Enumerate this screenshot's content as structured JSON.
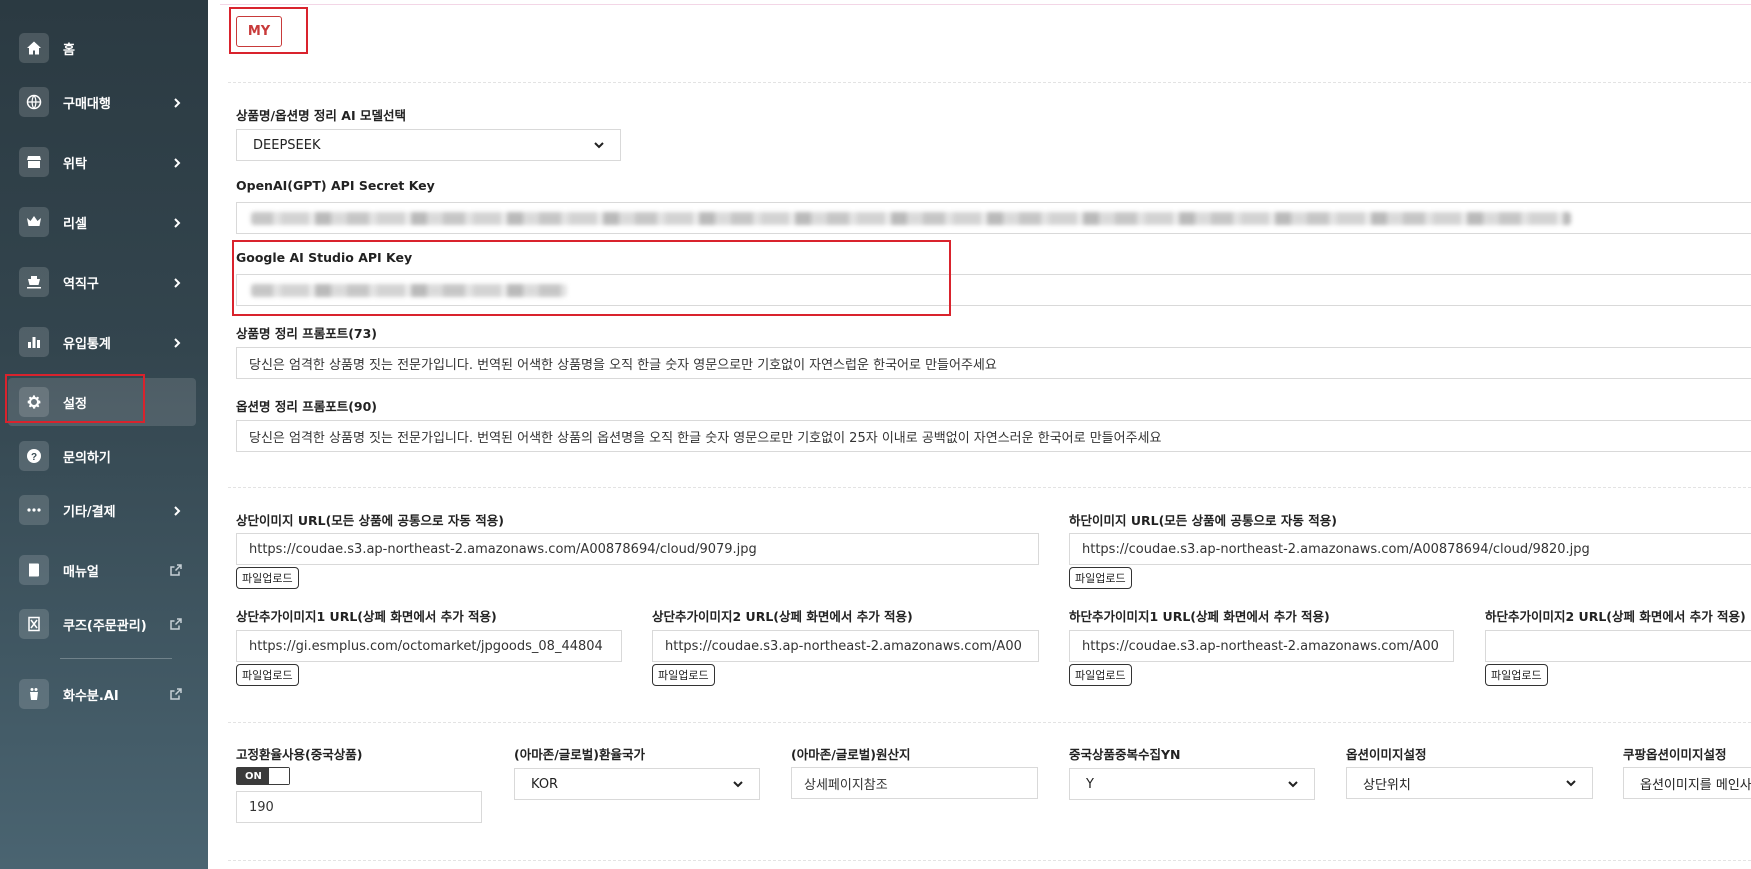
{
  "sidebar": {
    "items": [
      {
        "label": "홈",
        "icon": "home-icon"
      },
      {
        "label": "구매대행",
        "icon": "globe-icon"
      },
      {
        "label": "위탁",
        "icon": "store-icon"
      },
      {
        "label": "리셀",
        "icon": "crown-icon"
      },
      {
        "label": "역직구",
        "icon": "ship-icon"
      },
      {
        "label": "유입통계",
        "icon": "bar-chart-icon"
      },
      {
        "label": "설정",
        "icon": "gear-icon"
      },
      {
        "label": "문의하기",
        "icon": "question-icon"
      },
      {
        "label": "기타/결제",
        "icon": "more-icon"
      },
      {
        "label": "매뉴얼",
        "icon": "book-icon"
      },
      {
        "label": "쿠즈(주문관리)",
        "icon": "box-icon"
      },
      {
        "label": "화수분.AI",
        "icon": "ai-logo-icon"
      }
    ]
  },
  "header": {
    "my_label": "MY"
  },
  "ai_settings": {
    "model_label": "상품명/옵션명 정리 AI 모델선택",
    "model_value": "DEEPSEEK",
    "openai_label": "OpenAI(GPT) API Secret Key",
    "google_label": "Google AI Studio API Key",
    "product_prompt_label": "상품명 정리 프롬포트(73)",
    "product_prompt_value": "당신은 엄격한 상품명 짓는 전문가입니다. 번역된 어색한 상품명을 오직 한글 숫자 영문으로만 기호없이 자연스럽운 한국어로 만들어주세요",
    "option_prompt_label": "옵션명 정리 프롬포트(90)",
    "option_prompt_value": "당신은 엄격한 상품명 짓는 전문가입니다. 번역된 어색한 상품의 옵션명을 오직 한글 숫자 영문으로만 기호없이 25자 이내로 공백없이 자연스러운 한국어로 만들어주세요"
  },
  "images": {
    "upload_label": "파일업로드",
    "top_label": "상단이미지 URL(모든 상품에 공통으로 자동 적용)",
    "top_value": "https://coudae.s3.ap-northeast-2.amazonaws.com/A00878694/cloud/9079.jpg",
    "bottom_label": "하단이미지 URL(모든 상품에 공통으로 자동 적용)",
    "bottom_value": "https://coudae.s3.ap-northeast-2.amazonaws.com/A00878694/cloud/9820.jpg",
    "top_extra1_label": "상단추가이미지1 URL(상페 화면에서 추가 적용)",
    "top_extra1_value": "https://gi.esmplus.com/octomarket/jpgoods_08_44804",
    "top_extra2_label": "상단추가이미지2 URL(상페 화면에서 추가 적용)",
    "top_extra2_value": "https://coudae.s3.ap-northeast-2.amazonaws.com/A00",
    "bottom_extra1_label": "하단추가이미지1 URL(상페 화면에서 추가 적용)",
    "bottom_extra1_value": "https://coudae.s3.ap-northeast-2.amazonaws.com/A00",
    "bottom_extra2_label": "하단추가이미지2 URL(상페 화면에서 추가 적용)",
    "bottom_extra2_value": ""
  },
  "options": {
    "fixed_rate_label": "고정환율사용(중국상품)",
    "toggle_state": "ON",
    "fixed_rate_value": "190",
    "exchange_country_label": "(아마존/글로벌)환율국가",
    "exchange_country_value": "KOR",
    "origin_label": "(아마존/글로벌)원산지",
    "origin_value": "상세페이지참조",
    "dup_collect_label": "중국상품중복수집YN",
    "dup_collect_value": "Y",
    "option_image_label": "옵션이미지설정",
    "option_image_value": "상단위치",
    "coupang_option_label": "쿠팡옵션이미지설정",
    "coupang_option_value": "옵션이미지를 메인사"
  },
  "colors": {
    "highlight": "#d9232d",
    "sidebar_bg": "#2b3a42"
  }
}
